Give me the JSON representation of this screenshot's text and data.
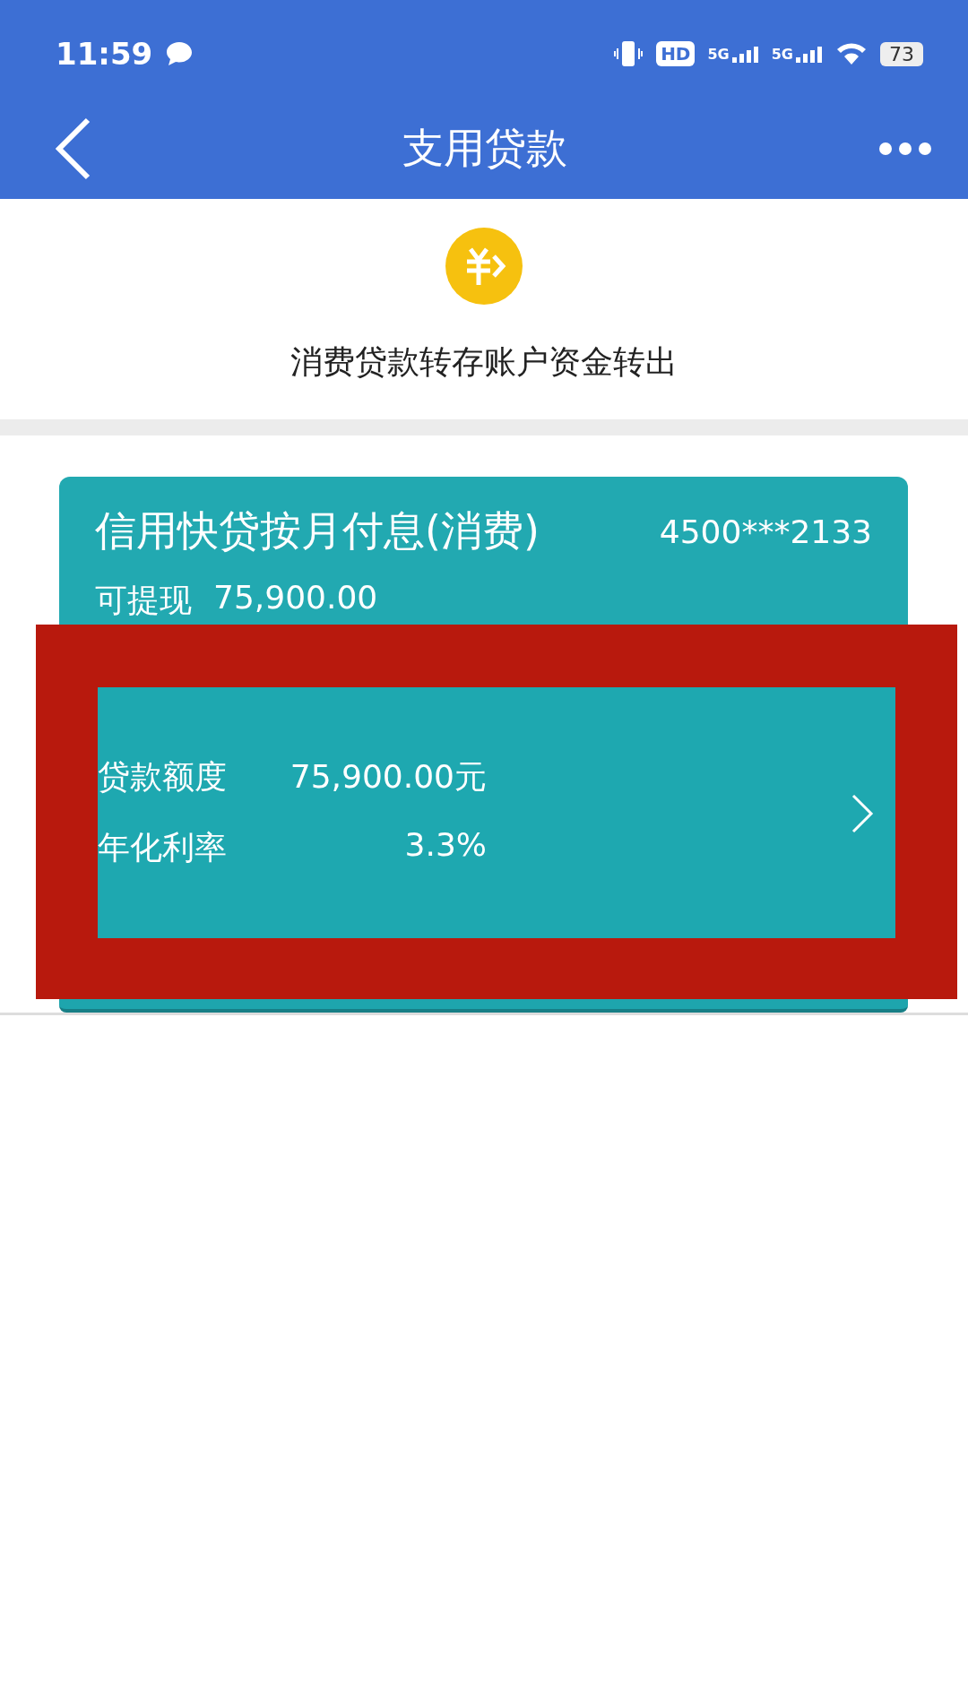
{
  "status_bar": {
    "time": "11:59",
    "hd_label": "HD",
    "network_labels": [
      "5G",
      "5G"
    ],
    "battery": "73"
  },
  "header": {
    "title": "支用贷款"
  },
  "banner": {
    "caption": "消费贷款转存账户资金转出"
  },
  "loan_card": {
    "product": "信用快贷按月付息(消费)",
    "account": "4500***2133",
    "withdrawable_label": "可提现",
    "withdrawable_amount": "75,900.00"
  },
  "overlay": {
    "rows": [
      {
        "label": "贷款额度",
        "value": "75,900.00元"
      },
      {
        "label": "年化利率",
        "value": "3.3%"
      }
    ]
  }
}
